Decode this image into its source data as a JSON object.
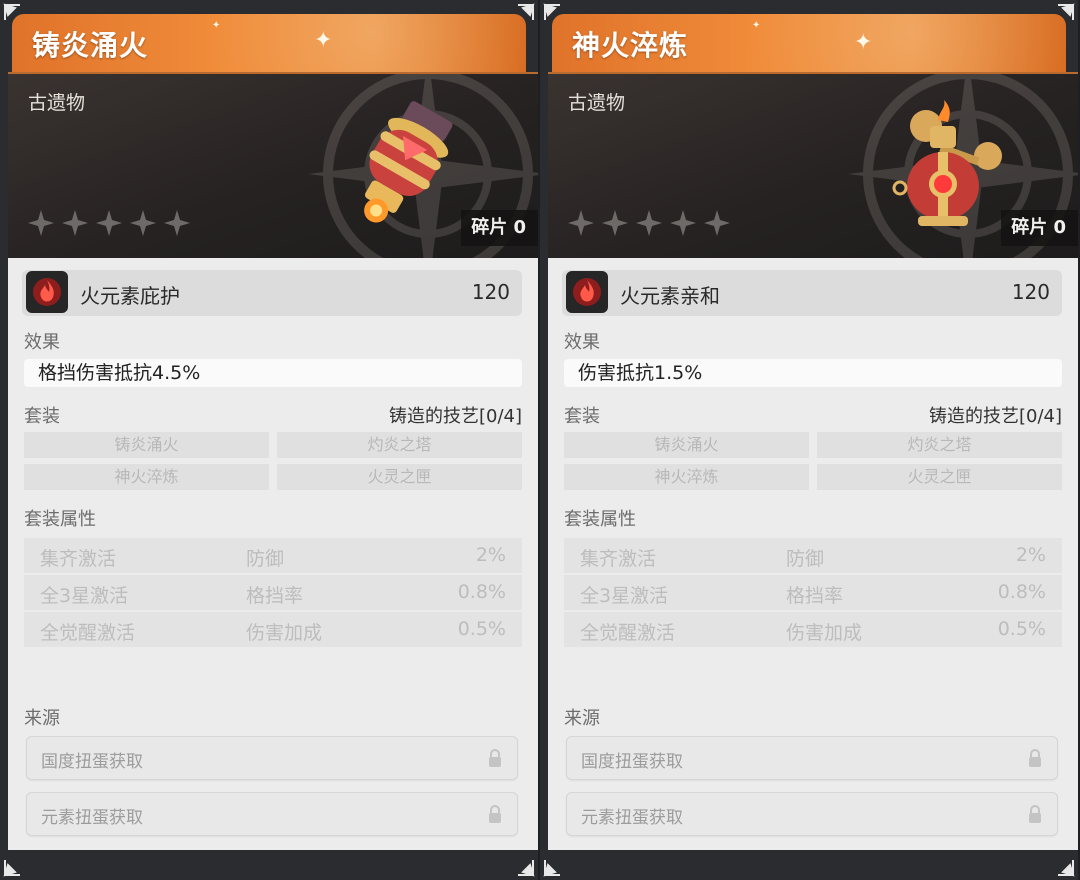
{
  "cards": [
    {
      "title": "铸炎涌火",
      "type": "古遗物",
      "stars_filled": 0,
      "stars_total": 5,
      "fragments": "碎片 0",
      "element": {
        "icon": "fire-element-icon",
        "name": "火元素庇护",
        "value": "120"
      },
      "effect_label": "效果",
      "effect": "格挡伤害抵抗4.5%",
      "set_label": "套装",
      "set_name": "铸造的技艺[0/4]",
      "set_items": [
        "铸炎涌火",
        "灼炎之塔",
        "神火淬炼",
        "火灵之匣"
      ],
      "attr_label": "套装属性",
      "attrs": [
        {
          "cond": "集齐激活",
          "stat": "防御",
          "value": "2%"
        },
        {
          "cond": "全3星激活",
          "stat": "格挡率",
          "value": "0.8%"
        },
        {
          "cond": "全觉醒激活",
          "stat": "伤害加成",
          "value": "0.5%"
        }
      ],
      "source_label": "来源",
      "sources": [
        "国度扭蛋获取",
        "元素扭蛋获取"
      ]
    },
    {
      "title": "神火淬炼",
      "type": "古遗物",
      "stars_filled": 0,
      "stars_total": 5,
      "fragments": "碎片 0",
      "element": {
        "icon": "fire-element-icon",
        "name": "火元素亲和",
        "value": "120"
      },
      "effect_label": "效果",
      "effect": "伤害抵抗1.5%",
      "set_label": "套装",
      "set_name": "铸造的技艺[0/4]",
      "set_items": [
        "铸炎涌火",
        "灼炎之塔",
        "神火淬炼",
        "火灵之匣"
      ],
      "attr_label": "套装属性",
      "attrs": [
        {
          "cond": "集齐激活",
          "stat": "防御",
          "value": "2%"
        },
        {
          "cond": "全3星激活",
          "stat": "格挡率",
          "value": "0.8%"
        },
        {
          "cond": "全觉醒激活",
          "stat": "伤害加成",
          "value": "0.5%"
        }
      ],
      "source_label": "来源",
      "sources": [
        "国度扭蛋获取",
        "元素扭蛋获取"
      ]
    }
  ],
  "colors": {
    "title_accent": "#e98a3a",
    "panel": "#ececec",
    "hero_bg": "#262222"
  }
}
